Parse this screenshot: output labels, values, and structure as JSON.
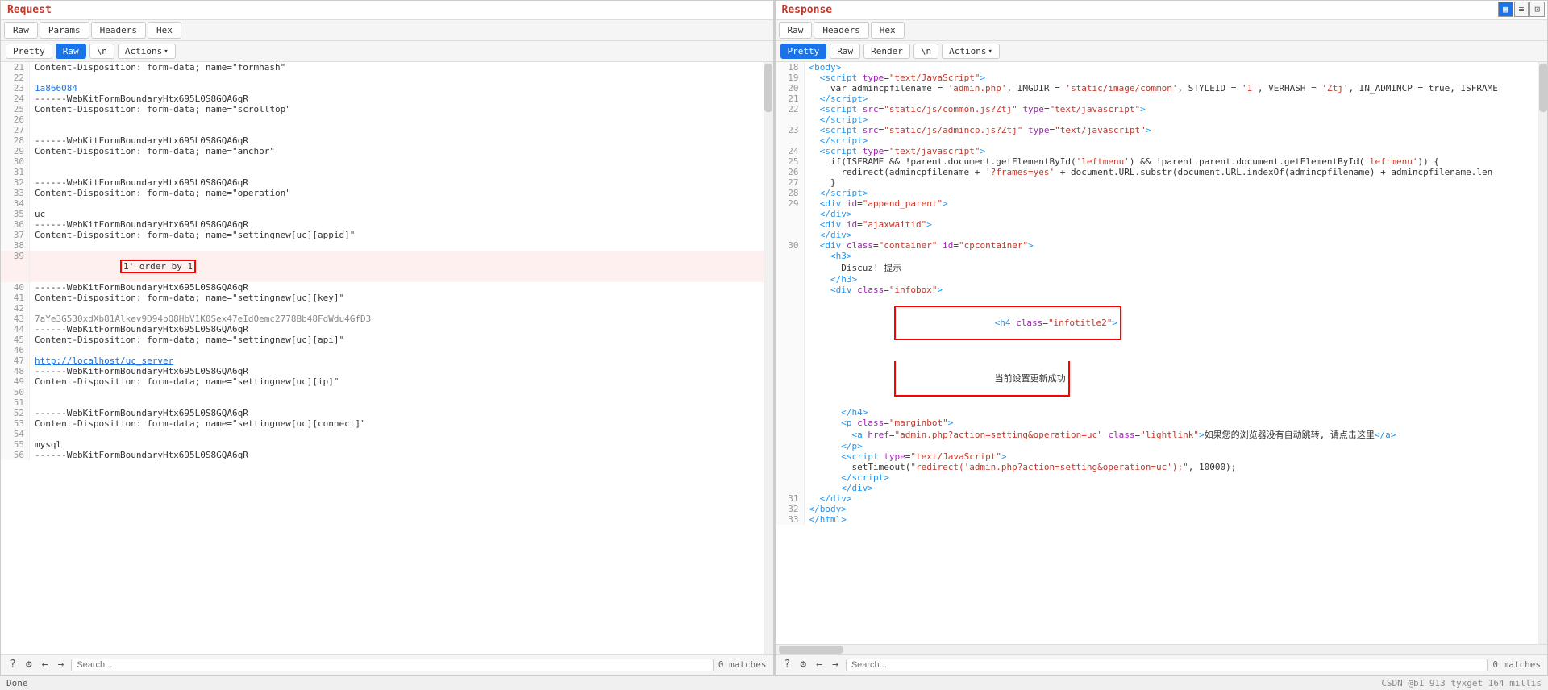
{
  "layout": {
    "top_right_buttons": [
      "grid-icon",
      "list-icon"
    ],
    "request_title": "Request",
    "response_title": "Response"
  },
  "request": {
    "tabs": [
      "Raw",
      "Params",
      "Headers",
      "Hex"
    ],
    "active_tab": "Raw",
    "toolbar": {
      "pretty_label": "Pretty",
      "raw_label": "Raw",
      "ln_label": "\\n",
      "actions_label": "Actions"
    },
    "search_placeholder": "Search...",
    "matches_label": "0 matches"
  },
  "response": {
    "tabs": [
      "Raw",
      "Headers",
      "Hex"
    ],
    "active_tab": "Raw",
    "toolbar": {
      "pretty_label": "Pretty",
      "raw_label": "Raw",
      "render_label": "Render",
      "ln_label": "\\n",
      "actions_label": "Actions"
    },
    "search_placeholder": "Search...",
    "matches_label": "0 matches"
  },
  "status_bar": {
    "left": "Done",
    "right": "CSDN @b1_913 tyxget 164 millis"
  }
}
